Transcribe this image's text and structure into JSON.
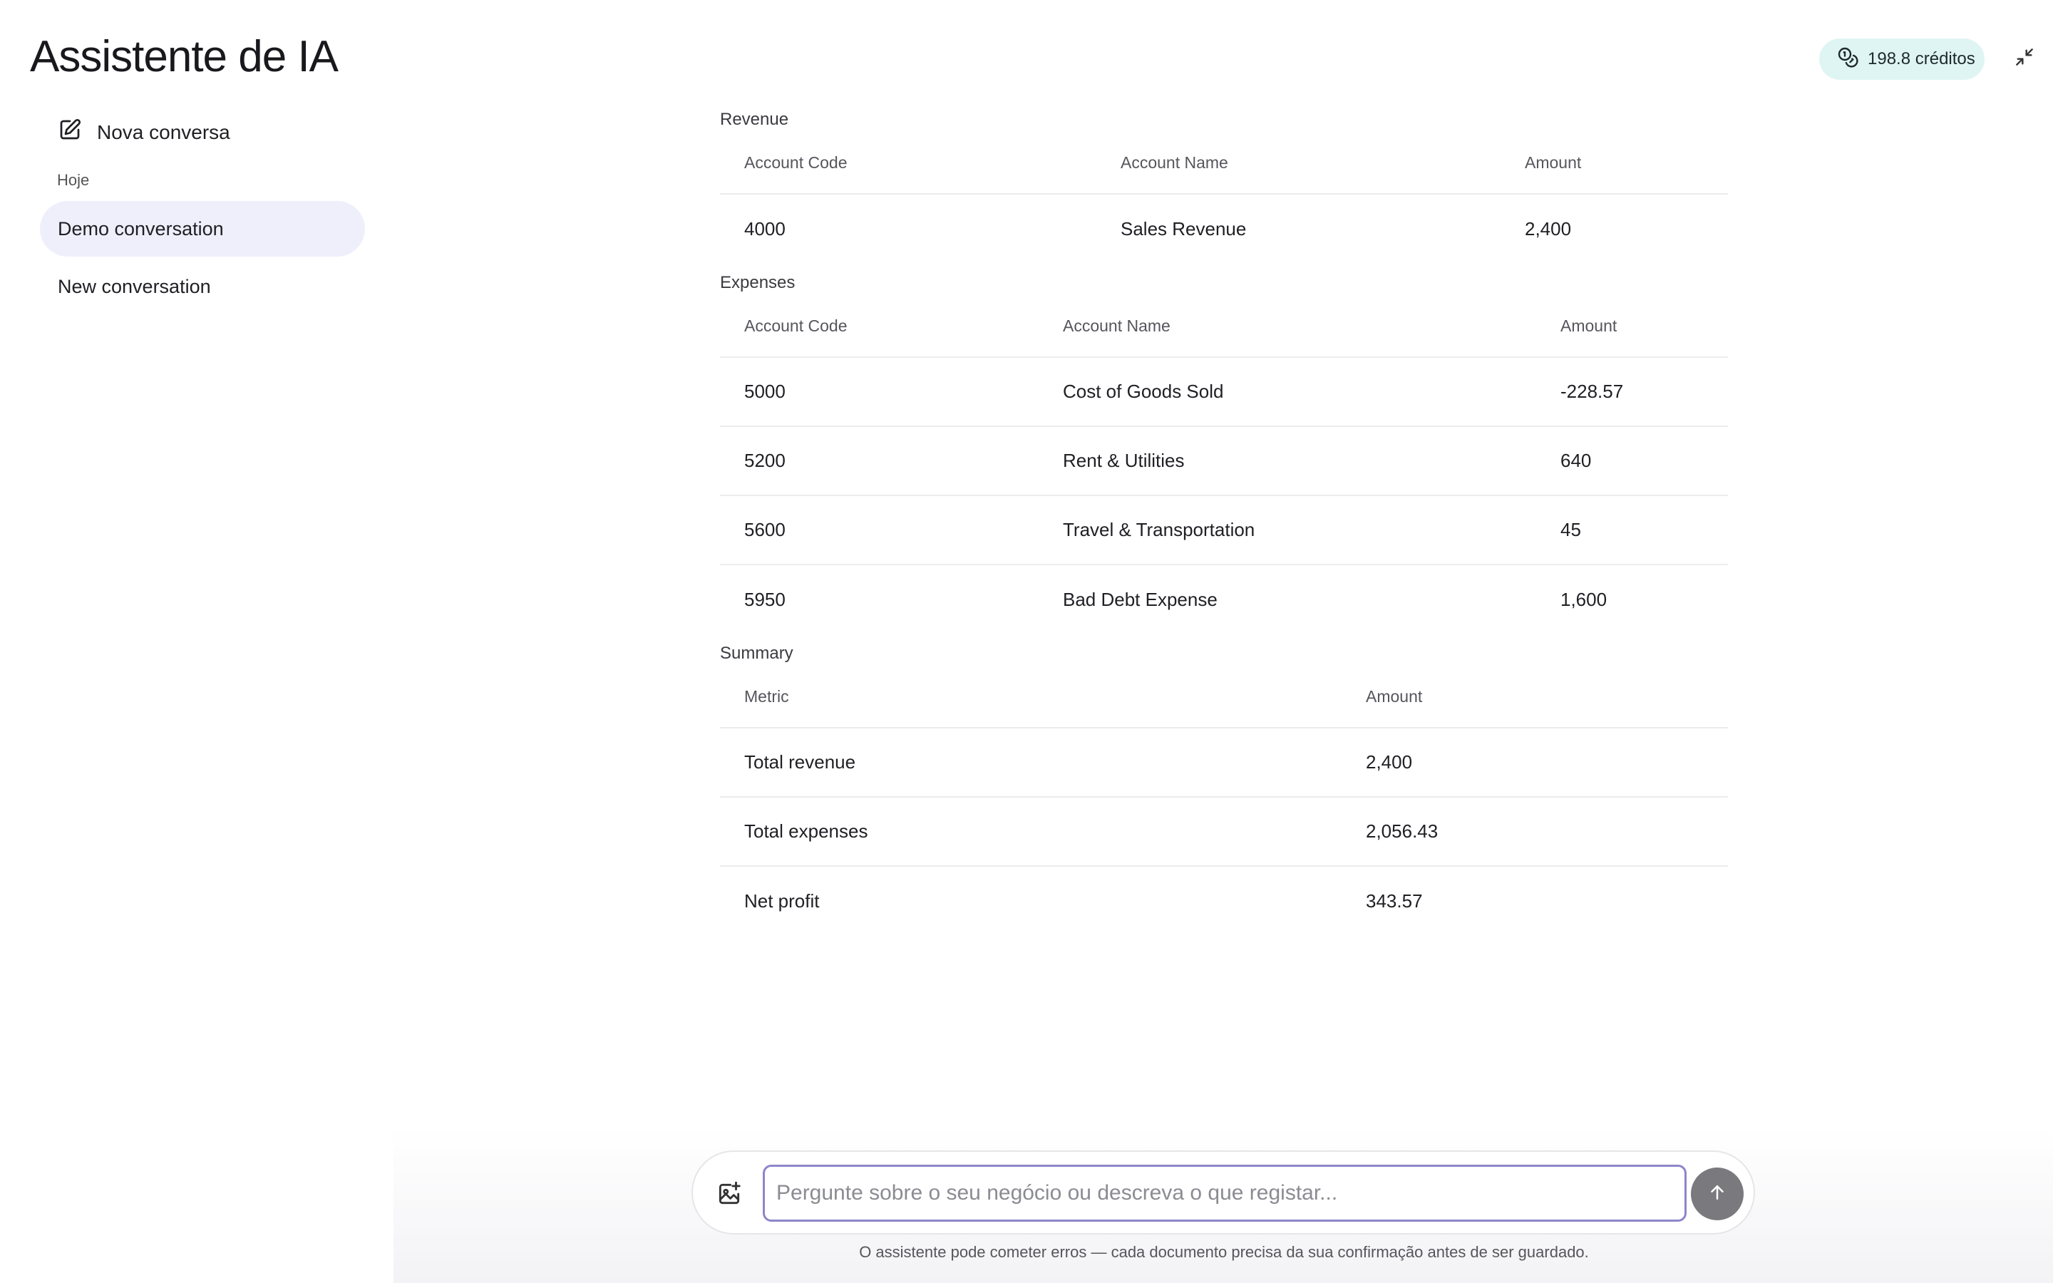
{
  "app_title": "Assistente de IA",
  "credits": {
    "label": "198.8 créditos",
    "icon": "coins-icon"
  },
  "sidebar": {
    "new_chat_label": "Nova conversa",
    "section_label": "Hoje",
    "items": [
      {
        "label": "Demo conversation",
        "active": true
      },
      {
        "label": "New conversation",
        "active": false
      }
    ]
  },
  "revenue": {
    "title": "Revenue",
    "headers": [
      "Account Code",
      "Account Name",
      "Amount"
    ],
    "rows": [
      [
        "4000",
        "Sales Revenue",
        "2,400"
      ]
    ]
  },
  "expenses": {
    "title": "Expenses",
    "headers": [
      "Account Code",
      "Account Name",
      "Amount"
    ],
    "rows": [
      [
        "5000",
        "Cost of Goods Sold",
        "-228.57"
      ],
      [
        "5200",
        "Rent & Utilities",
        "640"
      ],
      [
        "5600",
        "Travel & Transportation",
        "45"
      ],
      [
        "5950",
        "Bad Debt Expense",
        "1,600"
      ]
    ]
  },
  "summary": {
    "title": "Summary",
    "headers": [
      "Metric",
      "Amount"
    ],
    "rows": [
      [
        "Total revenue",
        "2,400"
      ],
      [
        "Total expenses",
        "2,056.43"
      ],
      [
        "Net profit",
        "343.57"
      ]
    ]
  },
  "composer": {
    "placeholder": "Pergunte sobre o seu negócio ou descreva o que registar...",
    "value": ""
  },
  "disclaimer": "O assistente pode cometer erros — cada documento precisa da sua confirmação antes de ser guardado."
}
